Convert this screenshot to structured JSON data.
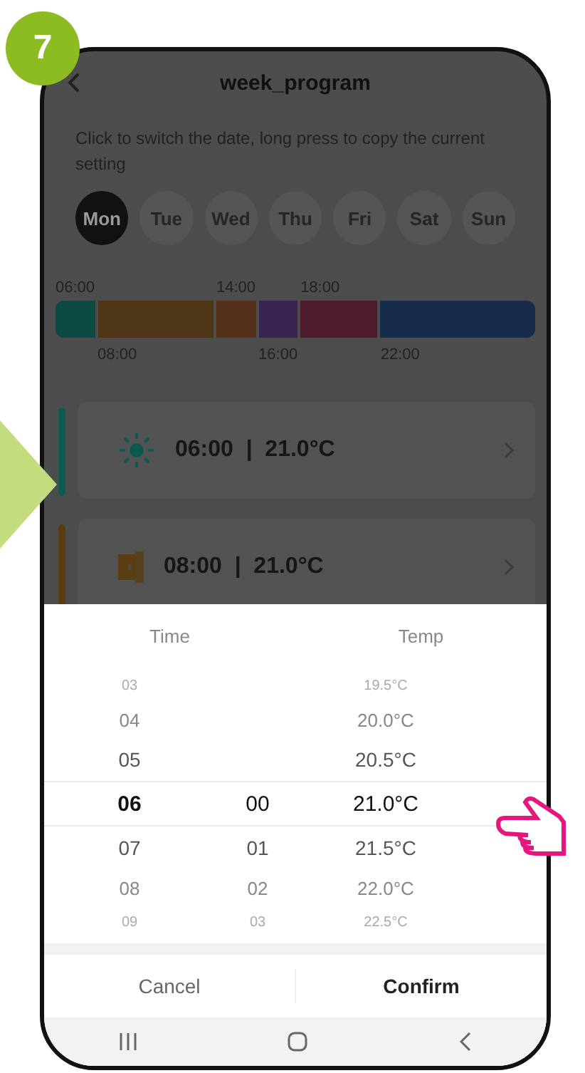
{
  "step_badge": "7",
  "header": {
    "title": "week_program"
  },
  "hint": "Click to switch the date, long press to copy the current setting",
  "days": [
    {
      "label": "Mon",
      "selected": true
    },
    {
      "label": "Tue",
      "selected": false
    },
    {
      "label": "Wed",
      "selected": false
    },
    {
      "label": "Thu",
      "selected": false
    },
    {
      "label": "Fri",
      "selected": false
    },
    {
      "label": "Sat",
      "selected": false
    },
    {
      "label": "Sun",
      "selected": false
    }
  ],
  "timeline": [
    {
      "start": "06:00",
      "color": "#0d4a42"
    },
    {
      "start": "08:00",
      "color": "#4f3617"
    },
    {
      "start": "14:00",
      "color": "#55301a"
    },
    {
      "start": "16:00",
      "color": "#3a2550"
    },
    {
      "start": "18:00",
      "color": "#4e1b2e"
    },
    {
      "start": "22:00",
      "color": "#162c4a"
    }
  ],
  "programs": [
    {
      "kind": "sun",
      "text": "06:00  |  21.0°C",
      "color": "#0d5a50"
    },
    {
      "kind": "door",
      "text": "08:00  |  21.0°C",
      "color": "#5a3d12"
    }
  ],
  "picker": {
    "headers": [
      "Time",
      "Temp"
    ],
    "rows": [
      {
        "hour": "03",
        "temp": "19.5°C",
        "selected": false
      },
      {
        "hour": "04",
        "temp": "20.0°C",
        "selected": false
      },
      {
        "hour": "05",
        "temp": "20.5°C",
        "selected": false
      },
      {
        "hour": "06",
        "minute": "00",
        "temp": "21.0°C",
        "selected": true
      },
      {
        "hour": "07",
        "minute": "01",
        "temp": "21.5°C",
        "selected": false
      },
      {
        "hour": "08",
        "minute": "02",
        "temp": "22.0°C",
        "selected": false
      },
      {
        "hour": "09",
        "minute": "03",
        "temp": "22.5°C",
        "selected": false
      }
    ]
  },
  "buttons": {
    "cancel": "Cancel",
    "confirm": "Confirm"
  }
}
